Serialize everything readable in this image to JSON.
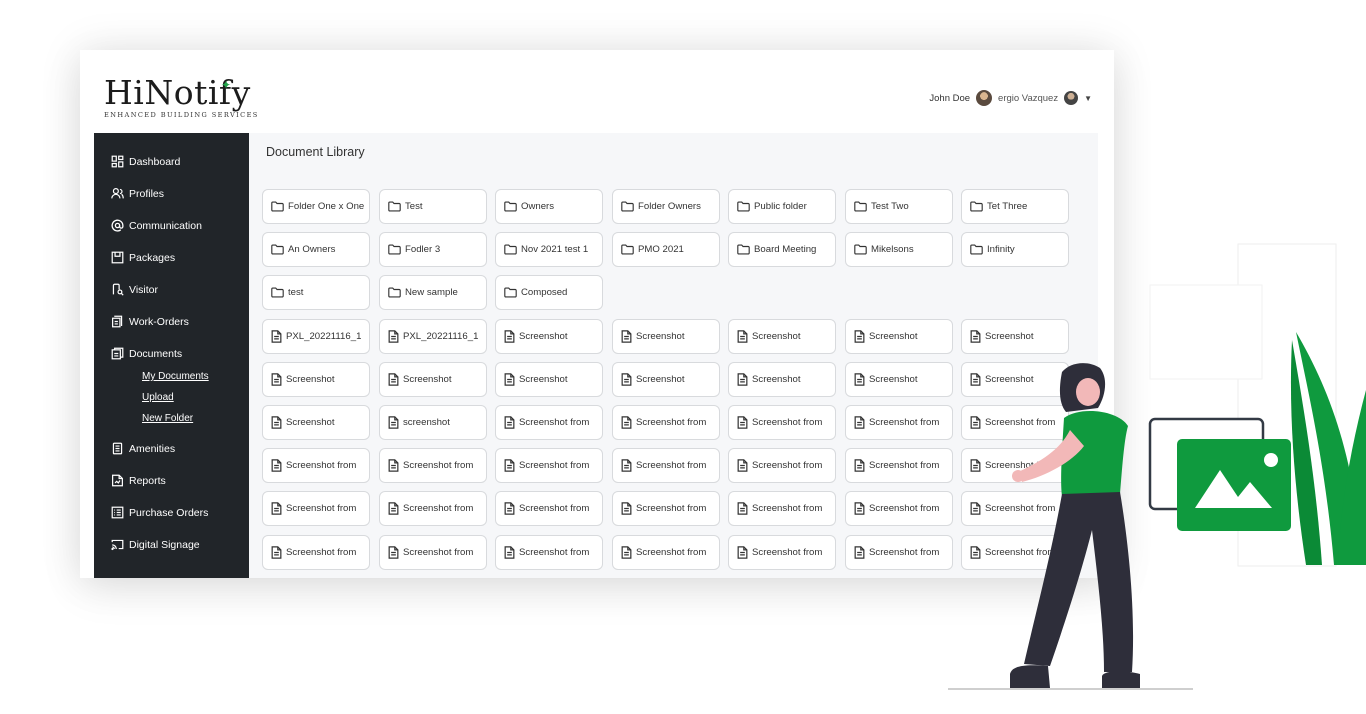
{
  "brand": {
    "name": "HiNotify",
    "tagline": "ENHANCED BUILDING SERVICES"
  },
  "user": {
    "name": "John Doe",
    "alt_user": "ergio Vazquez"
  },
  "page": {
    "title": "Document Library"
  },
  "sidebar": {
    "items": [
      {
        "label": "Dashboard",
        "icon": "dashboard-icon"
      },
      {
        "label": "Profiles",
        "icon": "people-icon"
      },
      {
        "label": "Communication",
        "icon": "at-icon"
      },
      {
        "label": "Packages",
        "icon": "package-icon"
      },
      {
        "label": "Visitor",
        "icon": "visitor-icon"
      },
      {
        "label": "Work-Orders",
        "icon": "clipboard-icon"
      },
      {
        "label": "Documents",
        "icon": "documents-icon"
      },
      {
        "label": "Amenities",
        "icon": "amenities-icon"
      },
      {
        "label": "Reports",
        "icon": "reports-icon"
      },
      {
        "label": "Purchase Orders",
        "icon": "list-icon"
      },
      {
        "label": "Digital Signage",
        "icon": "cast-icon"
      }
    ],
    "documents_sub": [
      "My Documents",
      "Upload",
      "New Folder"
    ]
  },
  "library": {
    "rows": [
      [
        {
          "t": "folder",
          "label": "Folder One x One"
        },
        {
          "t": "folder",
          "label": "Test"
        },
        {
          "t": "folder",
          "label": "Owners"
        },
        {
          "t": "folder",
          "label": "Folder Owners"
        },
        {
          "t": "folder",
          "label": "Public folder"
        },
        {
          "t": "folder",
          "label": "Test Two"
        },
        {
          "t": "folder",
          "label": "Tet Three"
        }
      ],
      [
        {
          "t": "folder",
          "label": "An Owners"
        },
        {
          "t": "folder",
          "label": "Fodler 3"
        },
        {
          "t": "folder",
          "label": "Nov 2021 test 1"
        },
        {
          "t": "folder",
          "label": "PMO 2021"
        },
        {
          "t": "folder",
          "label": "Board Meeting"
        },
        {
          "t": "folder",
          "label": "Mikelsons"
        },
        {
          "t": "folder",
          "label": "Infinity"
        }
      ],
      [
        {
          "t": "folder",
          "label": "test"
        },
        {
          "t": "folder",
          "label": "New sample"
        },
        {
          "t": "folder",
          "label": "Composed"
        }
      ],
      [
        {
          "t": "file",
          "label": "PXL_20221116_1"
        },
        {
          "t": "file",
          "label": "PXL_20221116_1"
        },
        {
          "t": "file",
          "label": "Screenshot"
        },
        {
          "t": "file",
          "label": "Screenshot"
        },
        {
          "t": "file",
          "label": "Screenshot"
        },
        {
          "t": "file",
          "label": "Screenshot"
        },
        {
          "t": "file",
          "label": "Screenshot"
        }
      ],
      [
        {
          "t": "file",
          "label": "Screenshot"
        },
        {
          "t": "file",
          "label": "Screenshot"
        },
        {
          "t": "file",
          "label": "Screenshot"
        },
        {
          "t": "file",
          "label": "Screenshot"
        },
        {
          "t": "file",
          "label": "Screenshot"
        },
        {
          "t": "file",
          "label": "Screenshot"
        },
        {
          "t": "file",
          "label": "Screenshot"
        }
      ],
      [
        {
          "t": "file",
          "label": "Screenshot"
        },
        {
          "t": "file",
          "label": "screenshot"
        },
        {
          "t": "file",
          "label": "Screenshot from"
        },
        {
          "t": "file",
          "label": "Screenshot from"
        },
        {
          "t": "file",
          "label": "Screenshot from"
        },
        {
          "t": "file",
          "label": "Screenshot from"
        },
        {
          "t": "file",
          "label": "Screenshot from"
        }
      ],
      [
        {
          "t": "file",
          "label": "Screenshot from"
        },
        {
          "t": "file",
          "label": "Screenshot from"
        },
        {
          "t": "file",
          "label": "Screenshot from"
        },
        {
          "t": "file",
          "label": "Screenshot from"
        },
        {
          "t": "file",
          "label": "Screenshot from"
        },
        {
          "t": "file",
          "label": "Screenshot from"
        },
        {
          "t": "file",
          "label": "Screenshot from"
        }
      ],
      [
        {
          "t": "file",
          "label": "Screenshot from"
        },
        {
          "t": "file",
          "label": "Screenshot from"
        },
        {
          "t": "file",
          "label": "Screenshot from"
        },
        {
          "t": "file",
          "label": "Screenshot from"
        },
        {
          "t": "file",
          "label": "Screenshot from"
        },
        {
          "t": "file",
          "label": "Screenshot from"
        },
        {
          "t": "file",
          "label": "Screenshot from"
        }
      ],
      [
        {
          "t": "file",
          "label": "Screenshot from"
        },
        {
          "t": "file",
          "label": "Screenshot from"
        },
        {
          "t": "file",
          "label": "Screenshot from"
        },
        {
          "t": "file",
          "label": "Screenshot from"
        },
        {
          "t": "file",
          "label": "Screenshot from"
        },
        {
          "t": "file",
          "label": "Screenshot from"
        },
        {
          "t": "file",
          "label": "Screenshot from"
        }
      ]
    ]
  },
  "colors": {
    "sidebar": "#212529",
    "accent_green": "#0f9a3e",
    "content_bg": "#f6f7f9"
  }
}
